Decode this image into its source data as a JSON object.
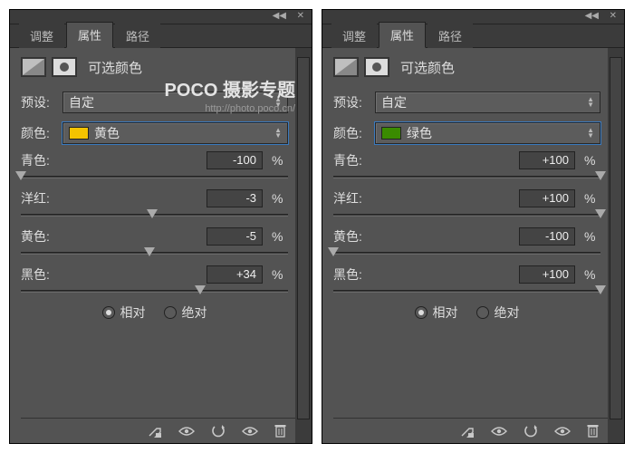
{
  "tabs": {
    "adjust": "调整",
    "properties": "属性",
    "path": "路径"
  },
  "panel_title": "可选颜色",
  "labels": {
    "preset": "预设:",
    "color": "颜色:",
    "pct": "%"
  },
  "sliders": {
    "cyan": "青色:",
    "magenta": "洋红:",
    "yellow": "黄色:",
    "black": "黑色:"
  },
  "radio": {
    "relative": "相对",
    "absolute": "绝对"
  },
  "left": {
    "preset_value": "自定",
    "color_value": "黄色",
    "color_swatch": "#f4c300",
    "values": {
      "cyan": "-100",
      "magenta": "-3",
      "yellow": "-5",
      "black": "+34"
    },
    "positions": {
      "cyan": 0,
      "magenta": 49,
      "yellow": 48,
      "black": 67
    }
  },
  "right": {
    "preset_value": "自定",
    "color_value": "绿色",
    "color_swatch": "#3a8b00",
    "values": {
      "cyan": "+100",
      "magenta": "+100",
      "yellow": "-100",
      "black": "+100"
    },
    "positions": {
      "cyan": 100,
      "magenta": 100,
      "yellow": 0,
      "black": 100
    }
  },
  "watermark": {
    "line1": "POCO 摄影专题",
    "line2": "http://photo.poco.cn/"
  }
}
